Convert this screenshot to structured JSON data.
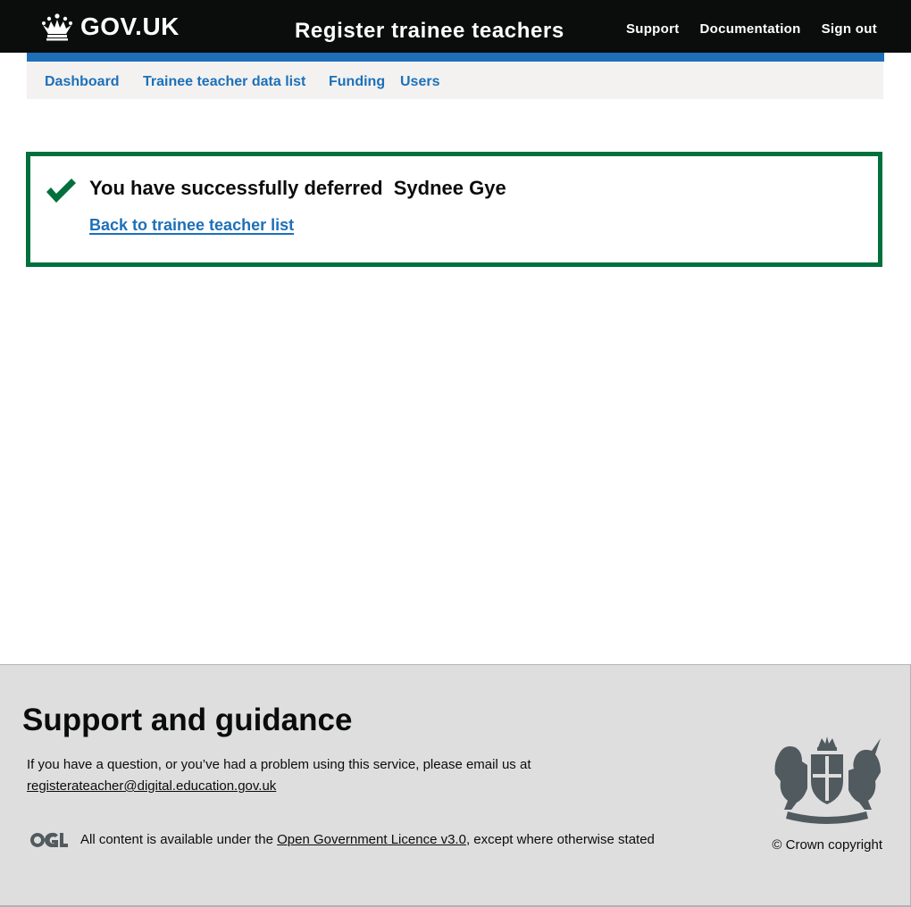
{
  "header": {
    "logo_text": "GOV.UK",
    "service_name": "Register trainee teachers",
    "nav": [
      {
        "label": "Support"
      },
      {
        "label": "Documentation"
      },
      {
        "label": "Sign out"
      }
    ]
  },
  "primary_nav": {
    "items": [
      {
        "label": "Dashboard"
      },
      {
        "label": "Trainee teacher data list"
      },
      {
        "label": "Funding"
      },
      {
        "label": "Users"
      }
    ]
  },
  "success_panel": {
    "title": "You have successfully deferred  Sydnee Gye",
    "link_label": "Back to trainee teacher list"
  },
  "footer": {
    "heading": "Support and guidance",
    "help_text": "If you have a question, or you’ve had a problem using this service, please email us at",
    "email": "registerateacher@digital.education.gov.uk",
    "licence_prefix": "All content is available under the ",
    "licence_link": "Open Government Licence v3.0",
    "licence_suffix": ", except where otherwise stated",
    "copyright": "© Crown copyright"
  },
  "colors": {
    "header_bg": "#0b0c0c",
    "brand_blue": "#1d70b8",
    "success_green": "#00703c",
    "nav_bg": "#f3f2f1",
    "footer_bg": "#dedede"
  },
  "icons": {
    "logo": "crown-icon",
    "panel": "check-icon",
    "licence": "ogl-logo",
    "footer": "royal-coat-of-arms"
  }
}
